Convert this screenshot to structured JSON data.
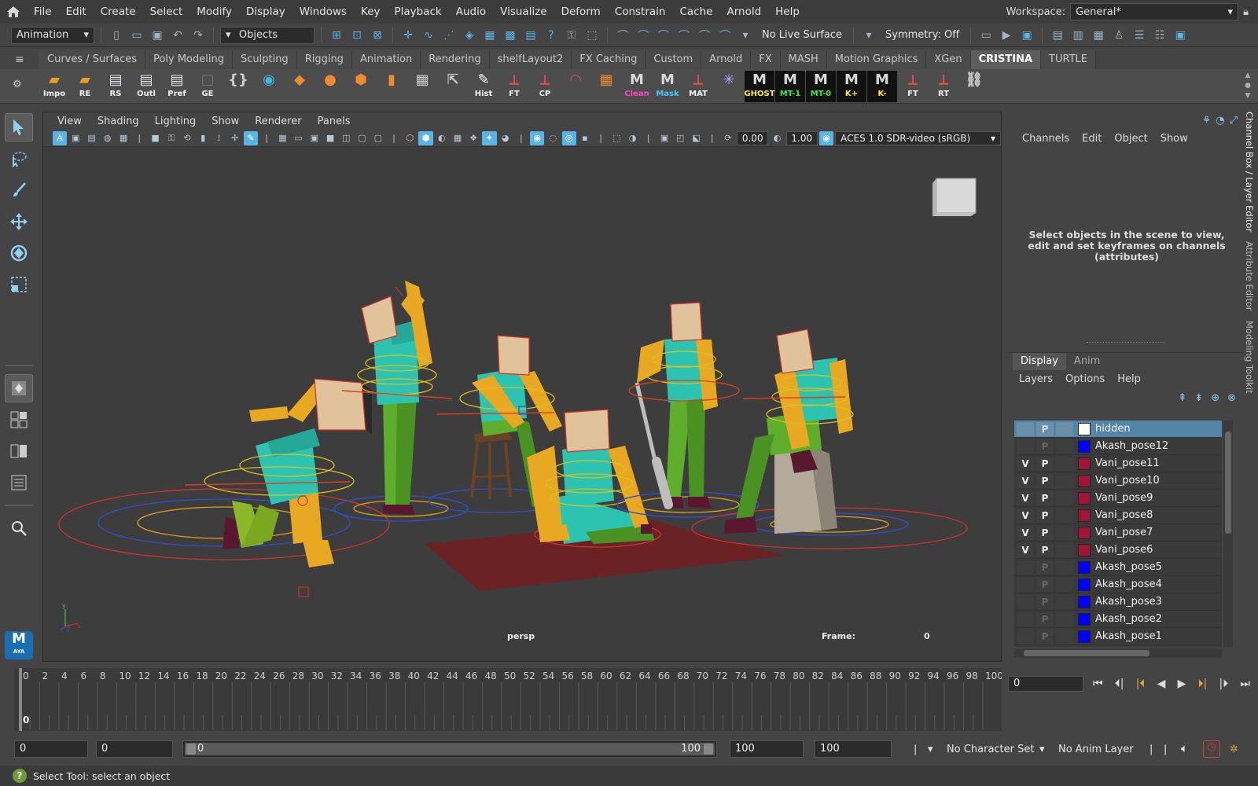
{
  "menubar": {
    "items": [
      "File",
      "Edit",
      "Create",
      "Select",
      "Modify",
      "Display",
      "Windows",
      "Key",
      "Playback",
      "Audio",
      "Visualize",
      "Deform",
      "Constrain",
      "Cache",
      "Arnold",
      "Help"
    ],
    "workspace_label": "Workspace:",
    "workspace_value": "General*"
  },
  "statusline": {
    "menu_set": "Animation",
    "selection_mode": "Objects",
    "live_surface": "No Live Surface",
    "symmetry": "Symmetry: Off"
  },
  "shelf": {
    "tabs": [
      "Curves / Surfaces",
      "Poly Modeling",
      "Sculpting",
      "Rigging",
      "Animation",
      "Rendering",
      "shelfLayout2",
      "FX Caching",
      "Custom",
      "Arnold",
      "FX",
      "MASH",
      "Motion Graphics",
      "XGen",
      "CRISTINA",
      "TURTLE"
    ],
    "active_tab": "CRISTINA",
    "buttons": [
      {
        "label": "Impo",
        "icon": "folder-icon",
        "color": "#e8a020"
      },
      {
        "label": "RE",
        "icon": "folder-icon",
        "color": "#e8a020"
      },
      {
        "label": "RS",
        "icon": "window-icon",
        "color": "#dfe6ee"
      },
      {
        "label": "Outl",
        "icon": "window-icon",
        "color": "#dfe6ee"
      },
      {
        "label": "Pref",
        "icon": "window-icon",
        "color": "#dfe6ee"
      },
      {
        "label": "GE",
        "icon": "blank-icon",
        "color": "#777777"
      },
      {
        "label": "",
        "icon": "script-icon",
        "color": "#cccccc"
      },
      {
        "label": "",
        "icon": "circle-icon",
        "color": "#3cb8e8"
      },
      {
        "label": "",
        "icon": "diamond-icon",
        "color": "#f08a2c"
      },
      {
        "label": "",
        "icon": "sphere-icon",
        "color": "#f08a2c"
      },
      {
        "label": "",
        "icon": "cube-icon",
        "color": "#f08a2c"
      },
      {
        "label": "",
        "icon": "cylinder-icon",
        "color": "#f08a2c"
      },
      {
        "label": "",
        "icon": "grid-icon",
        "color": "#cccccc"
      },
      {
        "label": "",
        "icon": "export-icon",
        "color": "#cccccc"
      },
      {
        "label": "Hist",
        "icon": "pencil-icon",
        "color": "#ffffff"
      },
      {
        "label": "FT",
        "icon": "axis-icon",
        "color": "#e84a4a"
      },
      {
        "label": "CP",
        "icon": "axis-icon",
        "color": "#e84a4a"
      },
      {
        "label": "",
        "icon": "arc-icon",
        "color": "#e84a4a"
      },
      {
        "label": "",
        "icon": "calendar-icon",
        "color": "#f08a2c"
      },
      {
        "label": "Clean",
        "icon": "m-icon",
        "color": "#ff44cc"
      },
      {
        "label": "Mask",
        "icon": "m-icon",
        "color": "#44ccff"
      },
      {
        "label": "MAT",
        "icon": "axis-icon",
        "color": "#e84a4a"
      },
      {
        "label": "",
        "icon": "star-icon",
        "color": "#b09cff"
      },
      {
        "label": "GHOST",
        "icon": "m-icon",
        "color": "#ffee33"
      },
      {
        "label": "MT-1",
        "icon": "m-icon",
        "color": "#33ee44"
      },
      {
        "label": "MT-0",
        "icon": "m-icon",
        "color": "#33ee44"
      },
      {
        "label": "K+",
        "icon": "m-icon",
        "color": "#ffee33"
      },
      {
        "label": "K-",
        "icon": "m-icon",
        "color": "#ffee33"
      },
      {
        "label": "FT",
        "icon": "axis-icon",
        "color": "#e84a4a"
      },
      {
        "label": "RT",
        "icon": "axis-icon",
        "color": "#e84a4a"
      },
      {
        "label": "",
        "icon": "link-icon",
        "color": "#cccccc"
      }
    ]
  },
  "viewport": {
    "menus": [
      "View",
      "Shading",
      "Lighting",
      "Show",
      "Renderer",
      "Panels"
    ],
    "exposure": "0.00",
    "gamma": "1.00",
    "color_space": "ACES 1.0 SDR-video (sRGB)",
    "camera": "persp",
    "frame_label": "Frame:",
    "frame_value": "0"
  },
  "channelbox": {
    "menus": [
      "Channels",
      "Edit",
      "Object",
      "Show"
    ],
    "hint": "Select objects in the scene to view, edit and set keyframes on channels (attributes)"
  },
  "layer_editor": {
    "tabs": [
      "Display",
      "Anim"
    ],
    "active_tab": "Display",
    "menus": [
      "Layers",
      "Options",
      "Help"
    ],
    "layers": [
      {
        "v": "",
        "p": "P",
        "color": "#ffffff",
        "name": "hidden",
        "selected": true
      },
      {
        "v": "",
        "p": "P",
        "color": "#0000ff",
        "name": "Akash_pose12",
        "selected": false
      },
      {
        "v": "V",
        "p": "P",
        "color": "#a01438",
        "name": "Vani_pose11",
        "selected": false
      },
      {
        "v": "V",
        "p": "P",
        "color": "#a01438",
        "name": "Vani_pose10",
        "selected": false
      },
      {
        "v": "V",
        "p": "P",
        "color": "#a01438",
        "name": "Vani_pose9",
        "selected": false
      },
      {
        "v": "V",
        "p": "P",
        "color": "#a01438",
        "name": "Vani_pose8",
        "selected": false
      },
      {
        "v": "V",
        "p": "P",
        "color": "#a01438",
        "name": "Vani_pose7",
        "selected": false
      },
      {
        "v": "V",
        "p": "P",
        "color": "#a01438",
        "name": "Vani_pose6",
        "selected": false
      },
      {
        "v": "",
        "p": "P",
        "color": "#0000ff",
        "name": "Akash_pose5",
        "selected": false
      },
      {
        "v": "",
        "p": "P",
        "color": "#0000ff",
        "name": "Akash_pose4",
        "selected": false
      },
      {
        "v": "",
        "p": "P",
        "color": "#0000ff",
        "name": "Akash_pose3",
        "selected": false
      },
      {
        "v": "",
        "p": "P",
        "color": "#0000ff",
        "name": "Akash_pose2",
        "selected": false
      },
      {
        "v": "",
        "p": "P",
        "color": "#0000ff",
        "name": "Akash_pose1",
        "selected": false
      }
    ]
  },
  "side_tabs": [
    "Channel Box / Layer Editor",
    "Attribute Editor",
    "Modeling Toolkit"
  ],
  "timeline": {
    "ticks": [
      0,
      2,
      4,
      6,
      8,
      10,
      12,
      14,
      16,
      18,
      20,
      22,
      24,
      26,
      28,
      30,
      32,
      34,
      36,
      38,
      40,
      42,
      44,
      46,
      48,
      50,
      52,
      54,
      56,
      58,
      60,
      62,
      64,
      66,
      68,
      70,
      72,
      74,
      76,
      78,
      80,
      82,
      84,
      86,
      88,
      90,
      92,
      94,
      96,
      98,
      100
    ],
    "current_marker": "0",
    "current_frame": "0"
  },
  "range": {
    "start": "0",
    "playback_start": "0",
    "slider_start": "0",
    "slider_end": "100",
    "playback_end": "100",
    "end": "100",
    "character_set": "No Character Set",
    "anim_layer": "No Anim Layer"
  },
  "helpline": {
    "text": "Select Tool: select an object"
  }
}
